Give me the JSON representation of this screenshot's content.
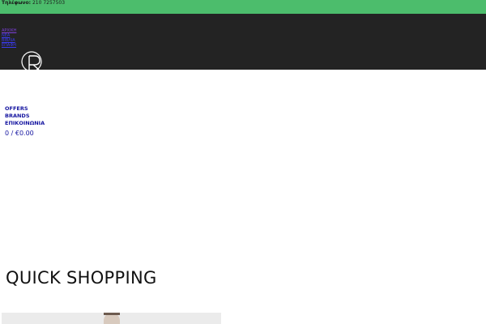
{
  "topbar": {
    "phone_label": "Τηλέφωνο:",
    "phone_number": "210 7257503"
  },
  "header": {
    "mini_nav": [
      "ΑΡΧΙΚΗ",
      "ΝΕΑ",
      "ΒΙΒΛΙΑ",
      "ΕΠΑΦΗ"
    ],
    "logo_icon": "r-monogram-logo"
  },
  "main_nav": {
    "items": [
      "OFFERS",
      "BRANDS",
      "ΕΠΙΚΟΙΝΩΝΙΑ"
    ]
  },
  "cart": {
    "summary": "0 / €0.00"
  },
  "section": {
    "title": "QUICK SHOPPING"
  },
  "colors": {
    "topbar_bg": "#4cbd6c",
    "header_bg": "#232323",
    "nav_link": "#1515a0"
  }
}
